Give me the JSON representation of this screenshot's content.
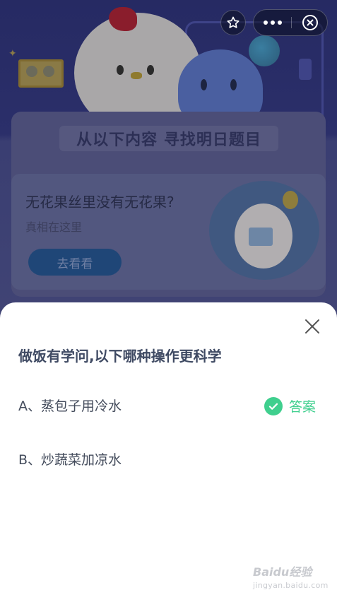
{
  "background": {
    "heading": "从以下内容 寻找明日题目",
    "promo": {
      "title": "无花果丝里没有无花果?",
      "subtitle": "真相在这里",
      "button_label": "去看看"
    }
  },
  "capsule": {
    "more_icon": "more-dots-icon",
    "close_icon": "close-circle-icon",
    "star_icon": "star-outline-icon"
  },
  "sheet": {
    "question": "做饭有学问,以下哪种操作更科学",
    "options": [
      {
        "label": "A、蒸包子用冷水",
        "is_answer": true
      },
      {
        "label": "B、炒蔬菜加凉水",
        "is_answer": false
      }
    ],
    "answer_label": "答案",
    "answer_color": "#3fcf8e"
  },
  "watermark": {
    "brand": "Baidu经验",
    "url": "jingyan.baidu.com"
  }
}
